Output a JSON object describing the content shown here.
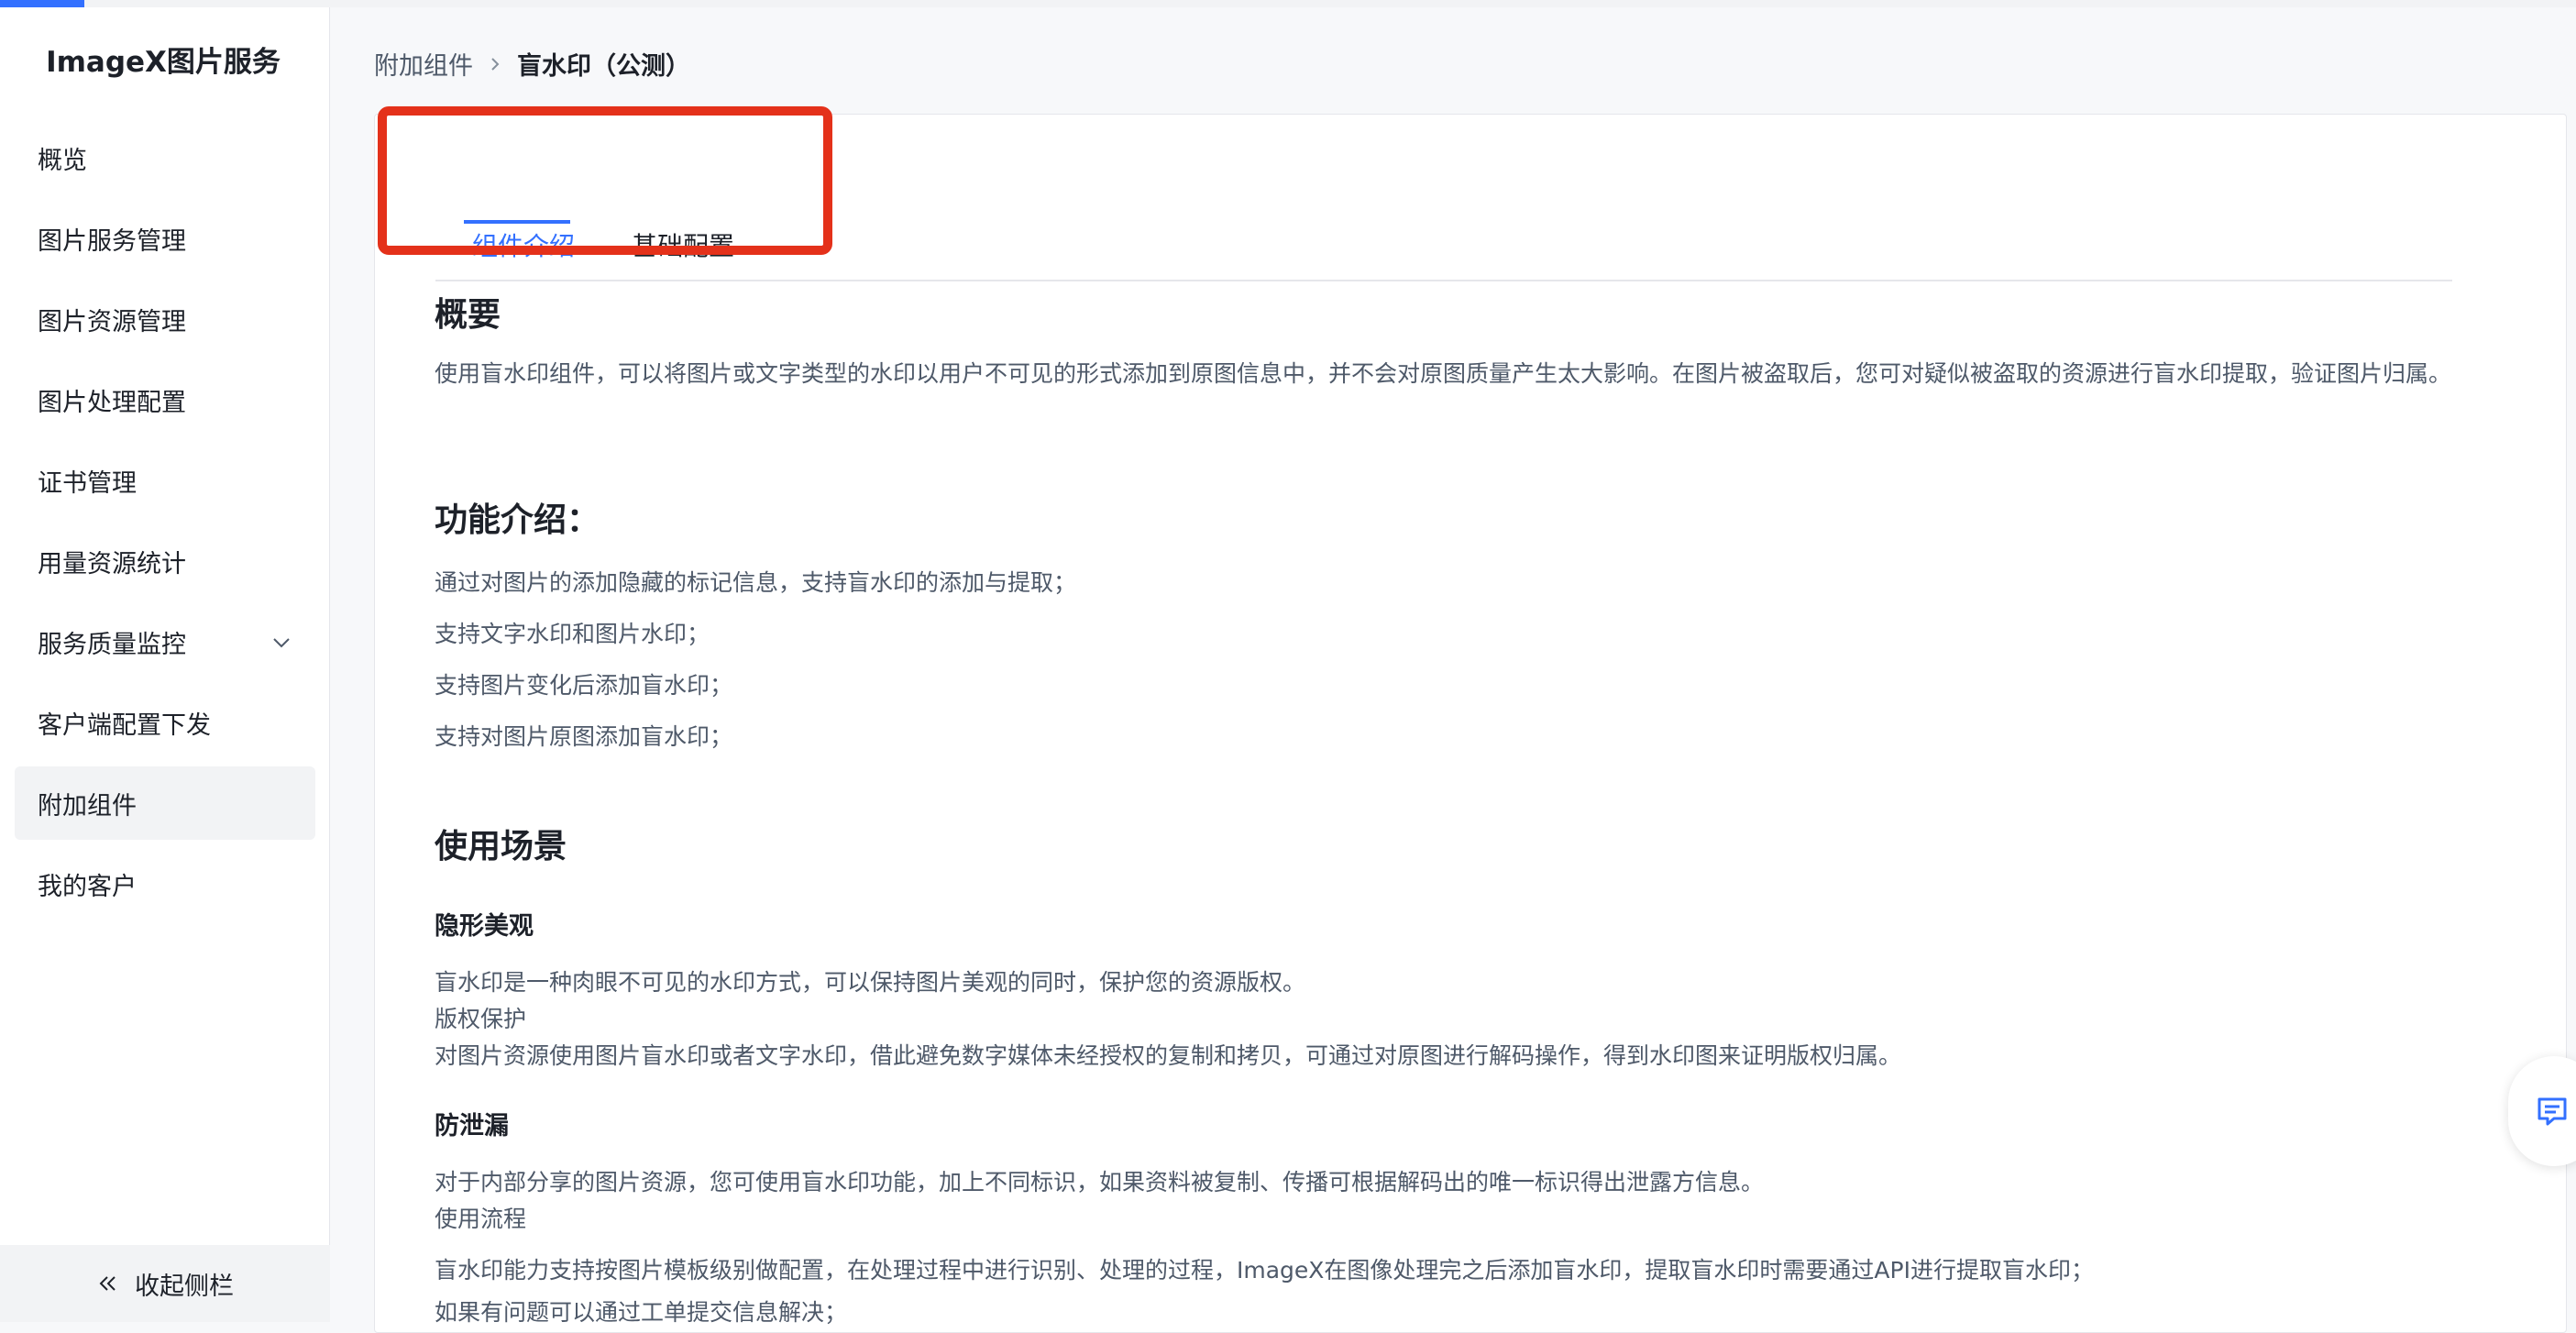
{
  "brand": "ImageX图片服务",
  "sidebar": {
    "items": [
      {
        "label": "概览"
      },
      {
        "label": "图片服务管理"
      },
      {
        "label": "图片资源管理"
      },
      {
        "label": "图片处理配置"
      },
      {
        "label": "证书管理"
      },
      {
        "label": "用量资源统计"
      },
      {
        "label": "服务质量监控"
      },
      {
        "label": "客户端配置下发"
      },
      {
        "label": "附加组件"
      },
      {
        "label": "我的客户"
      }
    ],
    "collapse_label": "收起侧栏"
  },
  "breadcrumb": {
    "parent": "附加组件",
    "current": "盲水印（公测）"
  },
  "tabs": [
    {
      "label": "组件介绍"
    },
    {
      "label": "基础配置"
    }
  ],
  "colors": {
    "accent": "#3370ff",
    "highlight_box": "#e4311a"
  },
  "content": {
    "overview_title": "概要",
    "overview_text": "使用盲水印组件，可以将图片或文字类型的水印以用户不可见的形式添加到原图信息中，并不会对原图质量产生太大影响。在图片被盗取后，您可对疑似被盗取的资源进行盲水印提取，验证图片归属。",
    "features_title": "功能介绍：",
    "features": [
      "通过对图片的添加隐藏的标记信息，支持盲水印的添加与提取；",
      "支持文字水印和图片水印；",
      "支持图片变化后添加盲水印；",
      "支持对图片原图添加盲水印；"
    ],
    "scenarios_title": "使用场景",
    "scenario1_title": "隐形美观",
    "scenario1_lines": [
      "盲水印是一种肉眼不可见的水印方式，可以保持图片美观的同时，保护您的资源版权。",
      "版权保护",
      "对图片资源使用图片盲水印或者文字水印，借此避免数字媒体未经授权的复制和拷贝，可通过对原图进行解码操作，得到水印图来证明版权归属。"
    ],
    "scenario2_title": "防泄漏",
    "scenario2_lines": [
      "对于内部分享的图片资源，您可使用盲水印功能，加上不同标识，如果资料被复制、传播可根据解码出的唯一标识得出泄露方信息。",
      "使用流程",
      "盲水印能力支持按图片模板级别做配置，在处理过程中进行识别、处理的过程，ImageX在图像处理完之后添加盲水印，提取盲水印时需要通过API进行提取盲水印；",
      "如果有问题可以通过工单提交信息解决；"
    ]
  },
  "icons": {
    "breadcrumb_separator": "chevron-right-icon",
    "monitor_expand": "chevron-down-icon",
    "collapse": "double-chevron-left-icon",
    "feedback": "message-icon"
  }
}
